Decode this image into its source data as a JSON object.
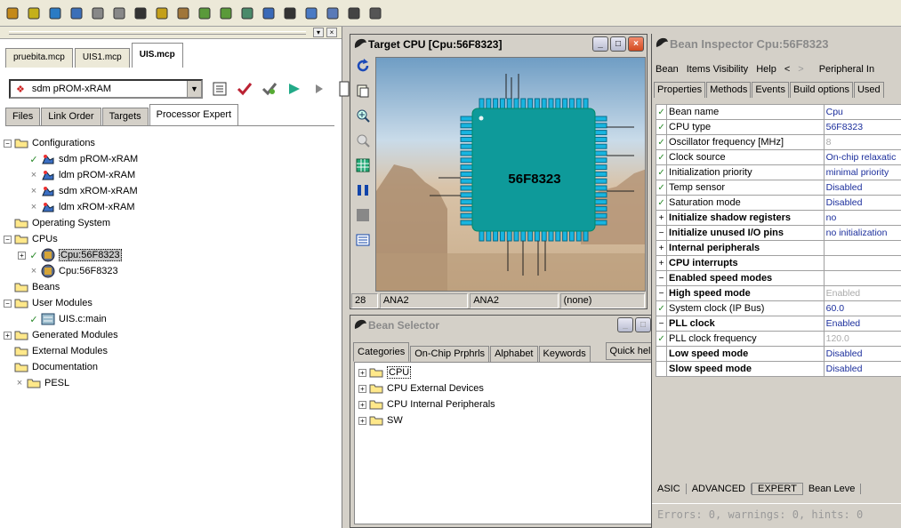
{
  "toolbar": {
    "icons": [
      "new-project-icon",
      "new-file-icon",
      "open-icon",
      "save-icon",
      "undo-icon",
      "redo-icon",
      "cut-icon",
      "copy-icon",
      "paste-icon",
      "make-icon",
      "debug-icon",
      "run-icon",
      "outline-icon",
      "bean-icon",
      "step-icon",
      "stop-icon",
      "window-icon",
      "help-icon"
    ]
  },
  "left_panel": {
    "project_tabs": [
      "pruebita.mcp",
      "UIS1.mcp",
      "UIS.mcp"
    ],
    "target": "sdm pROM-xRAM",
    "sub_tabs": [
      "Files",
      "Link Order",
      "Targets",
      "Processor Expert"
    ],
    "tree": [
      {
        "indent": 0,
        "exp": "−",
        "mark": "",
        "icon": "folder-icon",
        "label": "Configurations"
      },
      {
        "indent": 1,
        "exp": "",
        "mark": "✓",
        "icon": "config-icon",
        "label": "sdm pROM-xRAM"
      },
      {
        "indent": 1,
        "exp": "",
        "mark": "×",
        "icon": "config-icon",
        "label": "ldm pROM-xRAM"
      },
      {
        "indent": 1,
        "exp": "",
        "mark": "×",
        "icon": "config-icon",
        "label": "sdm xROM-xRAM"
      },
      {
        "indent": 1,
        "exp": "",
        "mark": "×",
        "icon": "config-icon",
        "label": "ldm xROM-xRAM"
      },
      {
        "indent": 0,
        "exp": "",
        "mark": "",
        "icon": "folder-icon",
        "label": "Operating System"
      },
      {
        "indent": 0,
        "exp": "−",
        "mark": "",
        "icon": "folder-icon",
        "label": "CPUs"
      },
      {
        "indent": 1,
        "exp": "+",
        "mark": "✓",
        "icon": "cpu-icon",
        "label": "Cpu:56F8323",
        "selected": true
      },
      {
        "indent": 1,
        "exp": "",
        "mark": "×",
        "icon": "cpu-icon",
        "label": "Cpu:56F8323"
      },
      {
        "indent": 0,
        "exp": "",
        "mark": "",
        "icon": "folder-icon",
        "label": "Beans"
      },
      {
        "indent": 0,
        "exp": "−",
        "mark": "",
        "icon": "folder-icon",
        "label": "User Modules"
      },
      {
        "indent": 1,
        "exp": "",
        "mark": "✓",
        "icon": "module-icon",
        "label": "UIS.c:main"
      },
      {
        "indent": 0,
        "exp": "+",
        "mark": "",
        "icon": "folder-icon",
        "label": "Generated Modules"
      },
      {
        "indent": 0,
        "exp": "",
        "mark": "",
        "icon": "folder-icon",
        "label": "External Modules"
      },
      {
        "indent": 0,
        "exp": "",
        "mark": "",
        "icon": "folder-icon",
        "label": "Documentation"
      },
      {
        "indent": 0,
        "exp": "",
        "mark": "×",
        "icon": "folder-icon",
        "label": "PESL"
      }
    ]
  },
  "cpu_window": {
    "title": "Target CPU [Cpu:56F8323]",
    "chip_label": "56F8323",
    "status": [
      "28",
      "ANA2",
      "ANA2",
      "(none)"
    ]
  },
  "bean_selector": {
    "title": "Bean Selector",
    "tabs": [
      "Categories",
      "On-Chip Prphrls",
      "Alphabet",
      "Keywords"
    ],
    "quick_help": "Quick help >",
    "tree": [
      "CPU",
      "CPU External Devices",
      "CPU Internal Peripherals",
      "SW"
    ]
  },
  "inspector": {
    "title": "Bean Inspector Cpu:56F8323",
    "menu": [
      "Bean",
      "Items Visibility",
      "Help",
      "<",
      ">",
      "Peripheral In"
    ],
    "tabs": [
      "Properties",
      "Methods",
      "Events",
      "Build options",
      "Used"
    ],
    "rows": [
      {
        "chk": "✓",
        "exp": "",
        "name": "Bean name",
        "value": "Cpu",
        "bold": false,
        "gray": false
      },
      {
        "chk": "✓",
        "exp": "",
        "name": "CPU type",
        "value": "56F8323",
        "bold": false,
        "gray": false
      },
      {
        "chk": "✓",
        "exp": "",
        "name": "Oscillator frequency [MHz]",
        "value": "8",
        "bold": false,
        "gray": true
      },
      {
        "chk": "✓",
        "exp": "",
        "name": "Clock source",
        "value": "On-chip relaxatic",
        "bold": false,
        "gray": false
      },
      {
        "chk": "✓",
        "exp": "",
        "name": "Initialization priority",
        "value": "minimal priority",
        "bold": false,
        "gray": false
      },
      {
        "chk": "✓",
        "exp": "",
        "name": "Temp sensor",
        "value": "Disabled",
        "bold": false,
        "gray": false
      },
      {
        "chk": "✓",
        "exp": "",
        "name": "Saturation mode",
        "value": "Disabled",
        "bold": false,
        "gray": false
      },
      {
        "chk": "",
        "exp": "+",
        "name": "Initialize shadow registers",
        "value": "no",
        "bold": true,
        "gray": false
      },
      {
        "chk": "",
        "exp": "−",
        "name": "Initialize unused I/O pins",
        "value": "no initialization",
        "bold": true,
        "gray": false
      },
      {
        "chk": "",
        "exp": "+",
        "name": "Internal peripherals",
        "value": "",
        "bold": true,
        "gray": false
      },
      {
        "chk": "",
        "exp": "+",
        "name": "CPU interrupts",
        "value": "",
        "bold": true,
        "gray": false
      },
      {
        "chk": "",
        "exp": "−",
        "name": "Enabled speed modes",
        "value": "",
        "bold": true,
        "gray": false
      },
      {
        "chk": "",
        "exp": "−",
        "name": "High speed mode",
        "value": "Enabled",
        "bold": true,
        "gray": true
      },
      {
        "chk": "✓",
        "exp": "",
        "name": "System clock (IP Bus)",
        "value": "60.0",
        "bold": false,
        "gray": false
      },
      {
        "chk": "",
        "exp": "−",
        "name": "PLL clock",
        "value": "Enabled",
        "bold": true,
        "gray": false
      },
      {
        "chk": "✓",
        "exp": "",
        "name": "PLL clock frequency",
        "value": "120.0",
        "bold": false,
        "gray": true
      },
      {
        "chk": "",
        "exp": "",
        "name": "Low speed mode",
        "value": "Disabled",
        "bold": true,
        "gray": false
      },
      {
        "chk": "",
        "exp": "",
        "name": "Slow speed mode",
        "value": "Disabled",
        "bold": true,
        "gray": false
      }
    ],
    "bottom_tabs": [
      "ASIC",
      "ADVANCED",
      "EXPERT",
      "Bean Leve"
    ],
    "status": "Errors: 0, warnings: 0, hints: 0"
  }
}
